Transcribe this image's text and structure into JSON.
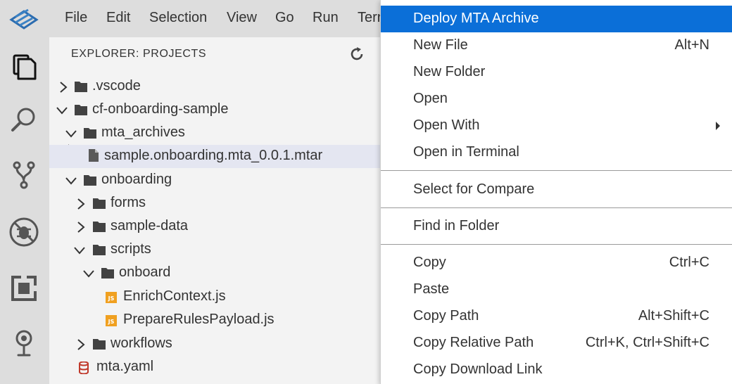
{
  "menubar": {
    "items": [
      "File",
      "Edit",
      "Selection",
      "View",
      "Go",
      "Run",
      "Terr"
    ]
  },
  "activitybar": {
    "icons": [
      "explorer-icon",
      "search-icon",
      "source-control-icon",
      "debug-icon",
      "extensions-icon",
      "cloud-foundry-icon"
    ]
  },
  "explorer": {
    "title": "EXPLORER: PROJECTS",
    "tree": [
      {
        "label": ".vscode",
        "type": "folder",
        "expanded": false
      },
      {
        "label": "cf-onboarding-sample",
        "type": "folder",
        "expanded": true
      },
      {
        "label": "mta_archives",
        "type": "folder",
        "expanded": true
      },
      {
        "label": "sample.onboarding.mta_0.0.1.mtar",
        "type": "file",
        "selected": true
      },
      {
        "label": "onboarding",
        "type": "folder",
        "expanded": true
      },
      {
        "label": "forms",
        "type": "folder",
        "expanded": false
      },
      {
        "label": "sample-data",
        "type": "folder",
        "expanded": false
      },
      {
        "label": "scripts",
        "type": "folder",
        "expanded": true
      },
      {
        "label": "onboard",
        "type": "folder",
        "expanded": true
      },
      {
        "label": "EnrichContext.js",
        "type": "js"
      },
      {
        "label": "PrepareRulesPayload.js",
        "type": "js"
      },
      {
        "label": "workflows",
        "type": "folder",
        "expanded": false
      },
      {
        "label": "mta.yaml",
        "type": "yaml"
      }
    ]
  },
  "context_menu": {
    "items": [
      {
        "label": "Deploy MTA Archive",
        "shortcut": "",
        "active": true
      },
      {
        "label": "New File",
        "shortcut": "Alt+N"
      },
      {
        "label": "New Folder",
        "shortcut": ""
      },
      {
        "label": "Open",
        "shortcut": ""
      },
      {
        "label": "Open With",
        "shortcut": "",
        "submenu": true
      },
      {
        "label": "Open in Terminal",
        "shortcut": ""
      },
      {
        "label": "Select for Compare",
        "shortcut": ""
      },
      {
        "label": "Find in Folder",
        "shortcut": ""
      },
      {
        "label": "Copy",
        "shortcut": "Ctrl+C"
      },
      {
        "label": "Paste",
        "shortcut": ""
      },
      {
        "label": "Copy Path",
        "shortcut": "Alt+Shift+C"
      },
      {
        "label": "Copy Relative Path",
        "shortcut": "Ctrl+K, Ctrl+Shift+C"
      },
      {
        "label": "Copy Download Link",
        "shortcut": ""
      }
    ]
  },
  "colors": {
    "accent": "#0b6fd8",
    "selection_bg": "#e4e6f1",
    "folder": "#424242",
    "js_badge": "#f0a020",
    "yaml_icon": "#c0392b"
  }
}
